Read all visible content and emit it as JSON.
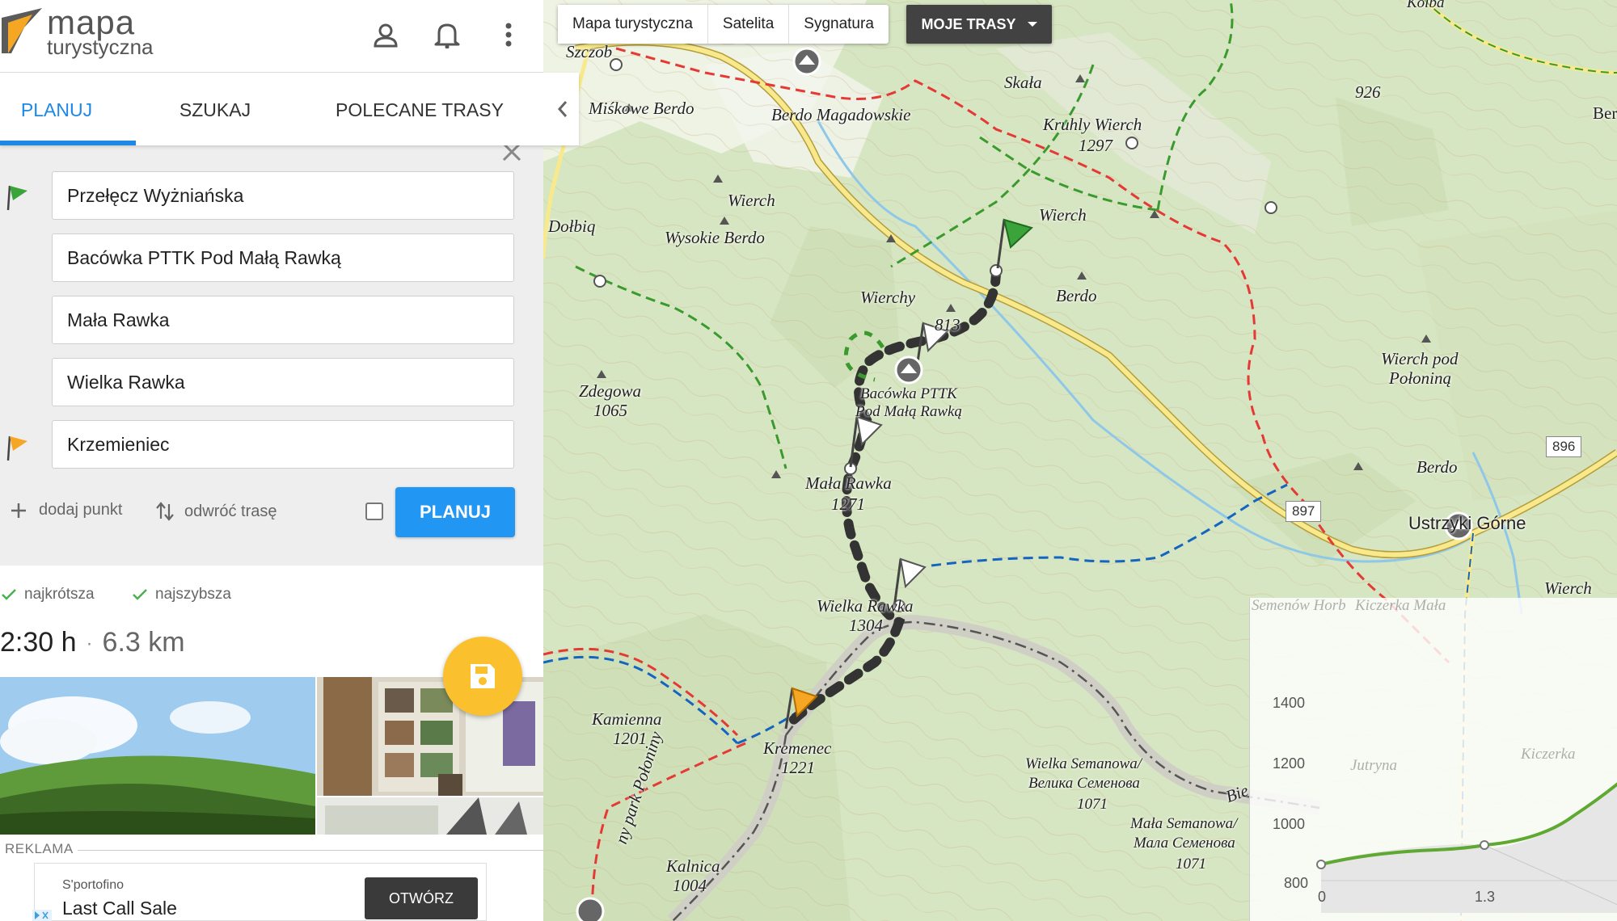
{
  "app": {
    "logo_line1": "mapa",
    "logo_line2": "turystyczna",
    "header_icons": [
      "user-icon",
      "bell-icon",
      "more-vert-icon"
    ]
  },
  "tabs": [
    {
      "label": "PLANUJ",
      "active": true
    },
    {
      "label": "SZUKAJ",
      "active": false
    },
    {
      "label": "POLECANE TRASY",
      "active": false
    }
  ],
  "route_points": [
    {
      "value": "Przełęcz Wyżniańska",
      "flag": "start"
    },
    {
      "value": "Bacówka PTTK Pod Małą Rawką",
      "flag": "none"
    },
    {
      "value": "Mała Rawka",
      "flag": "none"
    },
    {
      "value": "Wielka Rawka",
      "flag": "none"
    },
    {
      "value": "Krzemieniec",
      "flag": "end"
    }
  ],
  "actions": {
    "add_point": "dodaj punkt",
    "reverse": "odwróć trasę",
    "plan": "PLANUJ"
  },
  "options": {
    "shortest": "najkrótsza",
    "fastest": "najszybsza"
  },
  "summary": {
    "time": "2:30 h",
    "separator": "·",
    "distance": "6.3 km"
  },
  "ad": {
    "label": "REKLAMA",
    "brand": "S'portofino",
    "title": "Last Call Sale",
    "button": "OTWÓRZ"
  },
  "map_toolbar": {
    "tourist": "Mapa turystyczna",
    "satellite": "Satelita",
    "signature": "Sygnatura",
    "my_routes": "MOJE TRASY"
  },
  "map_labels": {
    "szczob": "Szczob",
    "miskowe": "Miśkowe Berdo",
    "berdo_mag": "Berdo Magadowskie",
    "skala": "Skała",
    "kruhly": "Kruhly Wierch",
    "kruhly_h": "1297",
    "wierch1": "Wierch",
    "wierch2": "Wierch",
    "wysokie": "Wysokie Berdo",
    "dolbiq": "Dołbiq",
    "wierchy": "Wierchy",
    "h813": "813",
    "berdo1": "Berdo",
    "bacowka1": "Bacówka PTTK",
    "bacowka2": "Pod Małą Rawką",
    "zdegowa": "Zdegowa",
    "zdegowa_h": "1065",
    "mala_rawka": "Mała Rawka",
    "mala_rawka_h": "1271",
    "wielka_rawka": "Wielka Rawka",
    "wielka_rawka_h": "1304",
    "kamienna": "Kamienna",
    "kamienna_h": "1201",
    "kremenec": "Kremenec",
    "kremenec_h": "1221",
    "wielka_semanowa": "Wielka Semanowa/",
    "wielka_semanowa_ua": "Велика Семенова",
    "wielka_semanowa_h": "1071",
    "mala_semanowa": "Mała Semanowa/",
    "mala_semanowa_ua": "Мала Семенова",
    "mala_semanowa_h": "1071",
    "kalnica": "Kalnica",
    "kalnica_h": "1004",
    "park": "ny park Połoniny",
    "wierch_pod1": "Wierch pod",
    "wierch_pod2": "Połoniną",
    "berdo2": "Berdo",
    "ustrzyki": "Ustrzyki Górne",
    "wierch3": "Wierch",
    "h926": "926",
    "kolba": "Kolba",
    "ber": "Ber",
    "bies": "Bie",
    "road_896": "896",
    "road_897": "897"
  },
  "elevation": {
    "y_ticks": [
      "1400",
      "1200",
      "1000",
      "800"
    ],
    "x_ticks": [
      "0",
      "1.3"
    ],
    "bg_labels": [
      "Semenów Horb",
      "Kiczerka Mała",
      "Jutryna",
      "Kiczerka"
    ]
  },
  "colors": {
    "accent": "#1e88e5",
    "fab": "#fbc02d",
    "route_dark": "#333333",
    "trail_red": "#e53935",
    "trail_green": "#3a9a2e",
    "trail_blue": "#1565c0",
    "road_yellow": "#f5d94a"
  }
}
